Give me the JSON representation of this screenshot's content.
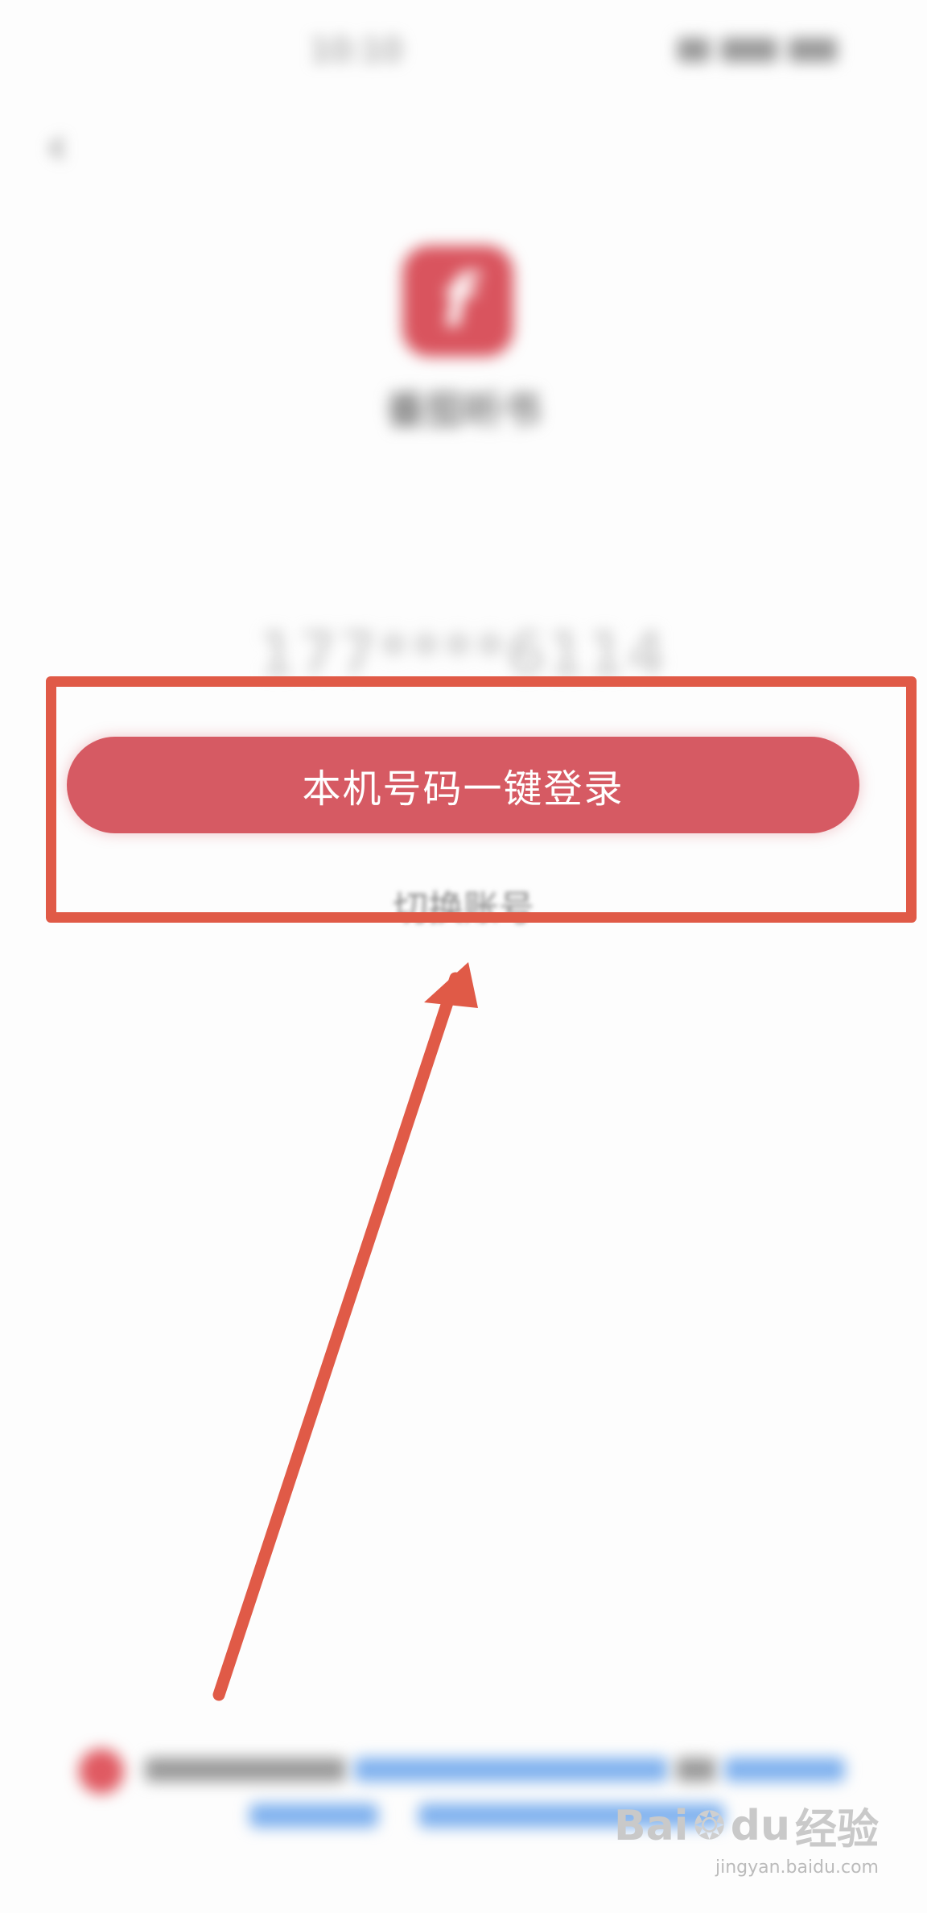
{
  "status_bar": {
    "time": "10:10",
    "icons": [
      "signal-icon",
      "wifi-icon",
      "battery-icon"
    ]
  },
  "nav": {
    "back_icon": "‹"
  },
  "app": {
    "logo_glyph": "f",
    "name": "番茄听书",
    "accent_color": "#d65a63"
  },
  "login": {
    "phone_number": "177****6114",
    "one_click_login_label": "本机号码一键登录",
    "switch_account_label": "切换账号"
  },
  "agreement": {
    "checkbox_state": "checked"
  },
  "annotation": {
    "box_color": "#e05a47",
    "arrow_color": "#e05a47"
  },
  "watermark": {
    "brand": "Bai",
    "brand_suffix": "du",
    "brand_cn": "经验",
    "url": "jingyan.baidu.com"
  }
}
